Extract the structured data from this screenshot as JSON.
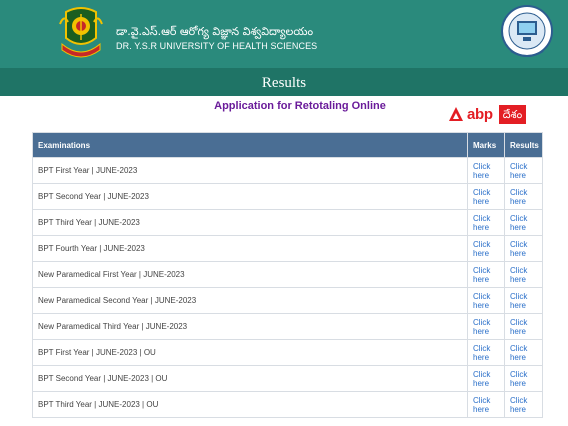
{
  "header": {
    "telugu_name": "డా.వై.ఎస్.ఆర్ ఆరోగ్య విజ్ఞాన విశ్వవిద్యాలయం",
    "english_name": "DR. Y.S.R UNIVERSITY OF HEALTH SCIENCES"
  },
  "banner": {
    "title": "Results"
  },
  "subtitle": "Application for Retotaling Online",
  "watermark": {
    "brand": "abp",
    "badge": "దేశం"
  },
  "table": {
    "headers": [
      "Examinations",
      "Marks",
      "Results"
    ],
    "rows": [
      {
        "exam": "BPT First Year | JUNE-2023",
        "marks": "Click here",
        "results": "Click here"
      },
      {
        "exam": "BPT Second Year | JUNE-2023",
        "marks": "Click here",
        "results": "Click here"
      },
      {
        "exam": "BPT Third Year | JUNE-2023",
        "marks": "Click here",
        "results": "Click here"
      },
      {
        "exam": "BPT Fourth Year | JUNE-2023",
        "marks": "Click here",
        "results": "Click here"
      },
      {
        "exam": "New Paramedical First Year | JUNE-2023",
        "marks": "Click here",
        "results": "Click here"
      },
      {
        "exam": "New Paramedical Second Year | JUNE-2023",
        "marks": "Click here",
        "results": "Click here"
      },
      {
        "exam": "New Paramedical Third Year | JUNE-2023",
        "marks": "Click here",
        "results": "Click here"
      },
      {
        "exam": "BPT First Year | JUNE-2023 | OU",
        "marks": "Click here",
        "results": "Click here"
      },
      {
        "exam": "BPT Second Year | JUNE-2023 | OU",
        "marks": "Click here",
        "results": "Click here"
      },
      {
        "exam": "BPT Third Year | JUNE-2023 | OU",
        "marks": "Click here",
        "results": "Click here"
      }
    ]
  },
  "colors": {
    "header_bg": "#2a8a7c",
    "banner_bg": "#1f7466",
    "table_header_bg": "#4a6e94",
    "link": "#2a6fc9",
    "subtitle": "#6a1b9a",
    "brand_red": "#e31e24"
  }
}
